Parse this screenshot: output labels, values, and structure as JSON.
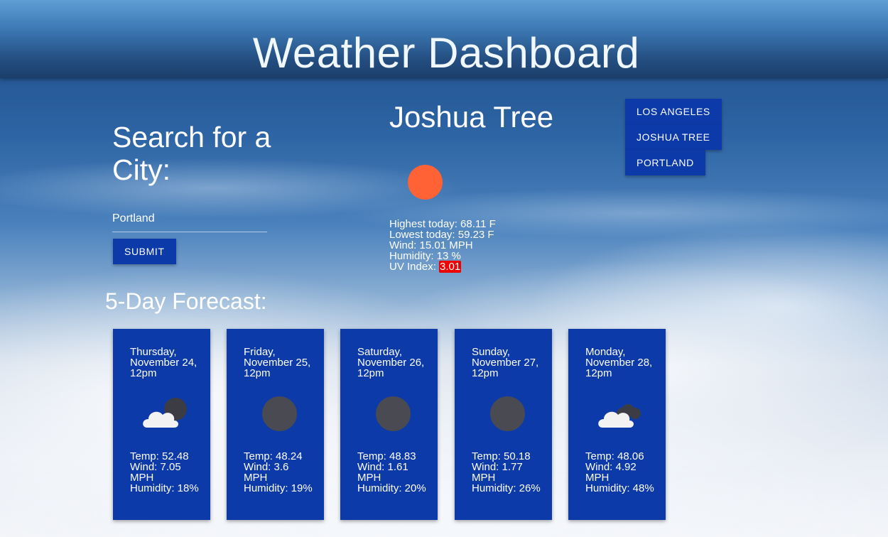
{
  "header": {
    "title": "Weather Dashboard"
  },
  "search": {
    "heading": "Search for a City:",
    "input_value": "Portland",
    "submit_label": "SUBMIT"
  },
  "history": [
    "LOS ANGELES",
    "JOSHUA TREE",
    "PORTLAND"
  ],
  "current": {
    "city": "Joshua Tree",
    "icon": "sun-icon",
    "high": "Highest today: 68.11 F",
    "low": "Lowest today: 59.23 F",
    "wind": "Wind: 15.01 MPH",
    "humidity": "Humidity: 13 %",
    "uv_label": "UV Index: ",
    "uv_value": "3.01"
  },
  "forecast": {
    "heading": "5-Day Forecast:",
    "days": [
      {
        "date": "Thursday, November 24, 12pm",
        "icon": "partly-cloudy-night-icon",
        "temp": "Temp: 52.48",
        "wind": "Wind: 7.05 MPH",
        "humidity": "Humidity: 18%"
      },
      {
        "date": "Friday, November 25, 12pm",
        "icon": "clear-night-icon",
        "temp": "Temp: 48.24",
        "wind": "Wind: 3.6 MPH",
        "humidity": "Humidity: 19%"
      },
      {
        "date": "Saturday, November 26, 12pm",
        "icon": "clear-night-icon",
        "temp": "Temp: 48.83",
        "wind": "Wind: 1.61 MPH",
        "humidity": "Humidity: 20%"
      },
      {
        "date": "Sunday, November 27, 12pm",
        "icon": "clear-night-icon",
        "temp": "Temp: 50.18",
        "wind": "Wind: 1.77 MPH",
        "humidity": "Humidity: 26%"
      },
      {
        "date": "Monday, November 28, 12pm",
        "icon": "cloudy-night-icon",
        "temp": "Temp: 48.06",
        "wind": "Wind: 4.92 MPH",
        "humidity": "Humidity: 48%"
      }
    ]
  },
  "colors": {
    "button": "#0d3aa9",
    "uv_badge": "#ee0000",
    "sun": "#ff6235"
  }
}
